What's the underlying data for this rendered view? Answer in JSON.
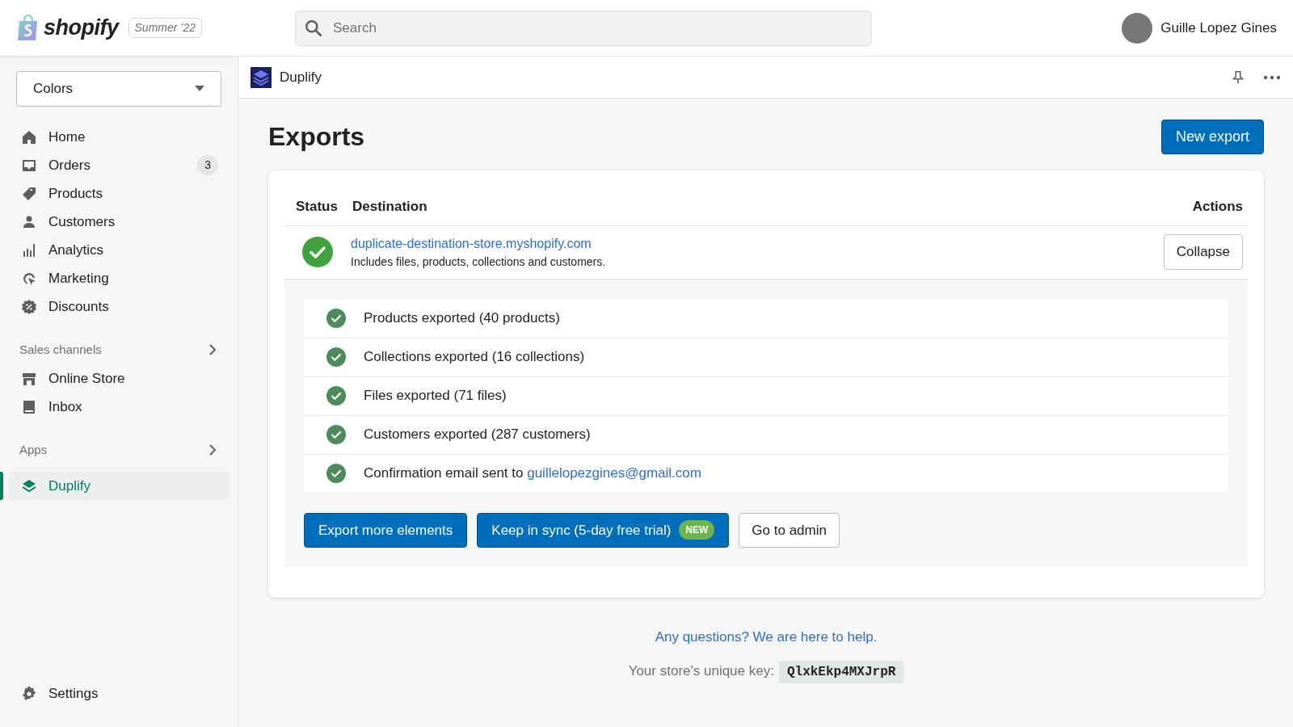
{
  "topbar": {
    "logo_text": "shopify",
    "edition": "Summer ’22",
    "search": {
      "placeholder": "Search"
    },
    "user_name": "Guille Lopez Gines"
  },
  "sidebar": {
    "store_selector": "Colors",
    "items": [
      {
        "label": "Home",
        "selected": false
      },
      {
        "label": "Orders",
        "badge": "3",
        "selected": false
      },
      {
        "label": "Products",
        "selected": false
      },
      {
        "label": "Customers",
        "selected": false
      },
      {
        "label": "Analytics",
        "selected": false
      },
      {
        "label": "Marketing",
        "selected": false
      },
      {
        "label": "Discounts",
        "selected": false
      }
    ],
    "sales_channels": {
      "title": "Sales channels",
      "items": [
        {
          "label": "Online Store",
          "selected": false
        },
        {
          "label": "Inbox",
          "selected": false
        }
      ]
    },
    "apps": {
      "title": "Apps",
      "items": [
        {
          "label": "Duplify",
          "selected": true
        }
      ]
    },
    "settings": "Settings"
  },
  "app_header": {
    "title": "Duplify"
  },
  "page": {
    "title": "Exports",
    "primary_action": "New export",
    "table": {
      "columns": [
        "Status",
        "Destination",
        "Actions"
      ],
      "row": {
        "destination": "duplicate-destination-store.myshopify.com",
        "description": "Includes files, products, collections and customers.",
        "action": "Collapse"
      }
    },
    "steps": [
      {
        "text": "Products exported (40 products)"
      },
      {
        "text": "Collections exported (16 collections)"
      },
      {
        "text": "Files exported (71 files)"
      },
      {
        "text": "Customers exported (287 customers)"
      },
      {
        "text": "Confirmation email sent to ",
        "link": "guillelopezgines@gmail.com"
      }
    ],
    "buttons": [
      {
        "label": "Export more elements",
        "kind": "primary"
      },
      {
        "label": "Keep in sync (5-day free trial)",
        "kind": "primary",
        "badge": "NEW"
      },
      {
        "label": "Go to admin",
        "kind": "secondary"
      }
    ],
    "help_link": "Any questions? We are here to help.",
    "key_label": "Your store's unique key:",
    "key": "QlxkEkp4MXJrpR"
  }
}
